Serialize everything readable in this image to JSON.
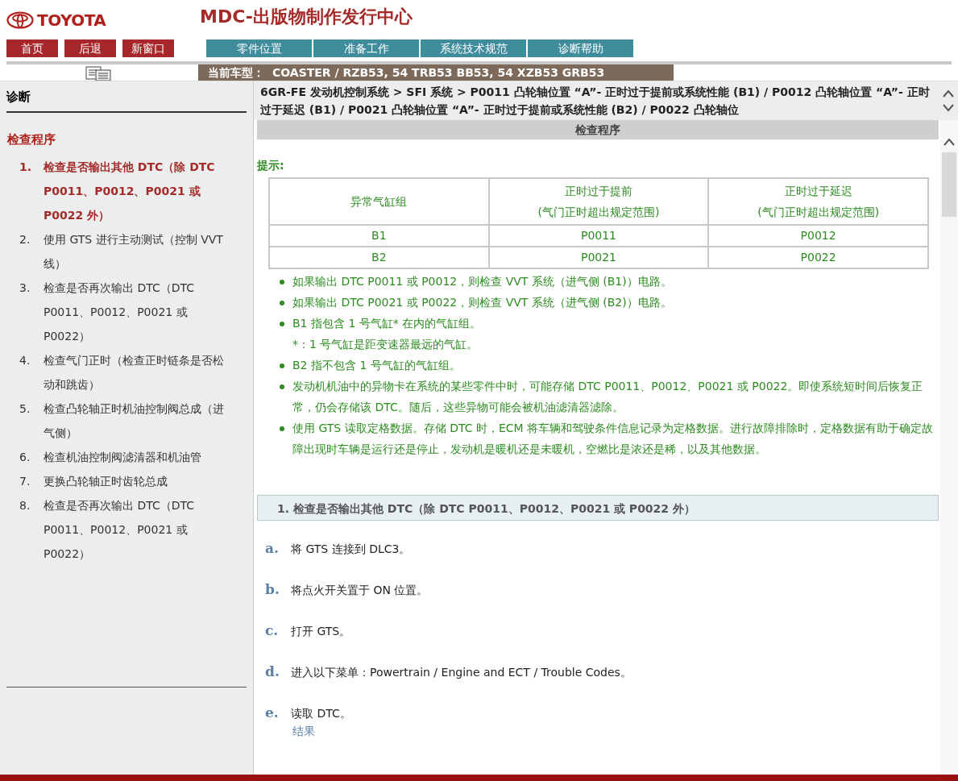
{
  "header": {
    "logo": "TOYOTA",
    "title": "MDC-出版物制作发行中心",
    "nav_buttons": [
      "首页",
      "后退",
      "新窗口"
    ],
    "tabs": [
      {
        "label": "零件位置",
        "selected": false
      },
      {
        "label": "准备工作",
        "selected": false
      },
      {
        "label": "系统技术规范",
        "selected": false
      },
      {
        "label": "诊断帮助",
        "selected": false
      }
    ],
    "model_bar": {
      "label": "当前车型：",
      "value": "COASTER / RZB53, 54 TRB53 BB53, 54 XZB53 GRB53"
    }
  },
  "sidebar": {
    "heading": "诊断",
    "section": "检查程序",
    "steps": [
      {
        "number": "1.",
        "text": "检查是否输出其他 DTC（除 DTC P0011、P0012、P0021 或 P0022 外）",
        "selected": true
      },
      {
        "number": "2.",
        "text": "使用 GTS 进行主动测试（控制 VVT 线）",
        "selected": false
      },
      {
        "number": "3.",
        "text": "检查是否再次输出 DTC（DTC P0011、P0012、P0021 或 P0022）",
        "selected": false
      },
      {
        "number": "4.",
        "text": "检查气门正时（检查正时链条是否松动和跳齿）",
        "selected": false
      },
      {
        "number": "5.",
        "text": "检查凸轮轴正时机油控制阀总成（进气侧）",
        "selected": false
      },
      {
        "number": "6.",
        "text": "检查机油控制阀滤清器和机油管",
        "selected": false
      },
      {
        "number": "7.",
        "text": "更换凸轮轴正时齿轮总成",
        "selected": false
      },
      {
        "number": "8.",
        "text": "检查是否再次输出 DTC（DTC P0011、P0012、P0021 或 P0022）",
        "selected": false
      }
    ]
  },
  "breadcrumb": "6GR-FE 发动机控制系统 > SFI 系统 > P0011 凸轮轴位置 “A”- 正时过于提前或系统性能 (B1) / P0012 凸轮轴位置 “A”- 正时过于延迟 (B1) / P0021 凸轮轴位置 “A”- 正时过于提前或系统性能 (B2) / P0022 凸轮轴位",
  "content": {
    "section_title": "检查程序",
    "hint_label": "提示:",
    "table": {
      "columns": [
        {
          "title": "异常气缸组"
        },
        {
          "title": "正时过于提前",
          "subtitle": "(气门正时超出规定范围)"
        },
        {
          "title": "正时过于延迟",
          "subtitle": "(气门正时超出规定范围)"
        }
      ],
      "rows": [
        [
          "B1",
          "P0011",
          "P0012"
        ],
        [
          "B2",
          "P0021",
          "P0022"
        ]
      ]
    },
    "bullets": [
      {
        "text": "如果输出 DTC P0011 或 P0012，则检查 VVT 系统（进气侧 (B1)）电路。"
      },
      {
        "text": "如果输出 DTC P0021 或 P0022，则检查 VVT 系统（进气侧 (B2)）电路。"
      },
      {
        "text": "B1 指包含 1 号气缸* 在内的气缸组。",
        "note": "*：1 号气缸是距变速器最远的气缸。"
      },
      {
        "text": "B2 指不包含 1 号气缸的气缸组。"
      },
      {
        "text": "发动机机油中的异物卡在系统的某些零件中时，可能存储 DTC P0011、P0012、P0021 或 P0022。即使系统短时间后恢复正常，仍会存储该 DTC。随后，这些异物可能会被机油滤清器滤除。"
      },
      {
        "text": "使用 GTS 读取定格数据。存储 DTC 时，ECM 将车辆和驾驶条件信息记录为定格数据。进行故障排除时，定格数据有助于确定故障出现时车辆是运行还是停止，发动机是暖机还是未暖机，空燃比是浓还是稀，以及其他数据。"
      }
    ],
    "step_heading": "1. 检查是否输出其他 DTC（除 DTC P0011、P0012、P0021 或 P0022 外）",
    "substeps": [
      {
        "letter": "a.",
        "text": "将 GTS 连接到 DLC3。"
      },
      {
        "letter": "b.",
        "text": "将点火开关置于 ON 位置。"
      },
      {
        "letter": "c.",
        "text": "打开 GTS。"
      },
      {
        "letter": "d.",
        "text": "进入以下菜单：Powertrain / Engine and ECT / Trouble Codes。"
      },
      {
        "letter": "e.",
        "text": "读取 DTC。"
      }
    ],
    "result_link": "结果"
  }
}
